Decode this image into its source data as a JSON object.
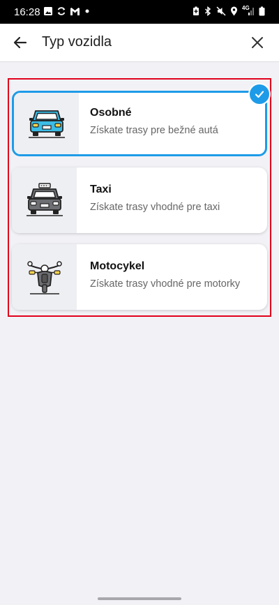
{
  "status_bar": {
    "time": "16:28",
    "network": "4G",
    "left_icons": [
      "image-icon",
      "sync-icon",
      "gmail-icon",
      "dot-icon"
    ],
    "right_icons": [
      "battery-saver-icon",
      "bluetooth-icon",
      "mute-icon",
      "location-icon",
      "signal-icon",
      "battery-icon"
    ]
  },
  "header": {
    "title": "Typ vozidla",
    "back_icon": "arrow-left-icon",
    "close_icon": "close-icon"
  },
  "vehicles": [
    {
      "id": "car",
      "title": "Osobné",
      "subtitle": "Získate trasy pre bežné autá",
      "icon": "car-icon",
      "selected": true
    },
    {
      "id": "taxi",
      "title": "Taxi",
      "subtitle": "Získate trasy vhodné pre taxi",
      "icon": "taxi-icon",
      "selected": false
    },
    {
      "id": "motorcycle",
      "title": "Motocykel",
      "subtitle": "Získate trasy vhodné pre motorky",
      "icon": "motorcycle-icon",
      "selected": false
    }
  ],
  "colors": {
    "accent": "#1e9be8",
    "highlight": "#e0001c",
    "car_body": "#3bbde6",
    "taxi_body": "#6e6f73",
    "background": "#f2f2f6"
  }
}
